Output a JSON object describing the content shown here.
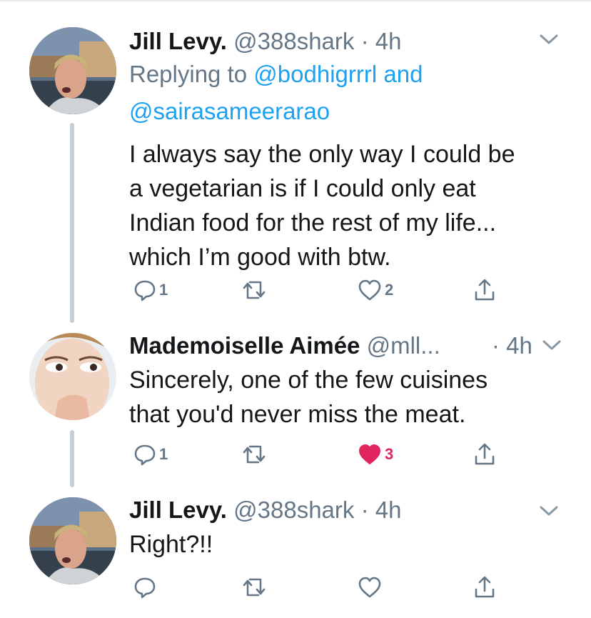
{
  "tweets": [
    {
      "name": "Jill Levy.",
      "handle": "@388shark",
      "time": "· 4h",
      "replying_prefix": "Replying to",
      "replying_mention1": "@bodhigrrrl",
      "replying_and": "and",
      "replying_mention2": "@sairasameerarao",
      "body": [
        "I always say the only way I could be",
        "a vegetarian is if I could only eat",
        "Indian food for the rest of my life...",
        "which I’m good with btw."
      ],
      "reply_count": "1",
      "retweet_count": "",
      "like_count": "2",
      "liked": false
    },
    {
      "name": "Mademoiselle Aimée",
      "handle": "@mll...",
      "time": "· 4h",
      "body": [
        "Sincerely, one of the few cuisines",
        "that you'd never miss the meat."
      ],
      "reply_count": "1",
      "retweet_count": "",
      "like_count": "3",
      "liked": true
    },
    {
      "name": "Jill Levy.",
      "handle": "@388shark",
      "time": "· 4h",
      "body": [
        "Right?!!"
      ],
      "reply_count": "",
      "retweet_count": "",
      "like_count": "",
      "liked": false
    }
  ],
  "colors": {
    "accent": "#1da1f2",
    "like": "#e0245e",
    "muted": "#657786",
    "thread": "#c4cfd6"
  },
  "icons": {
    "reply": "reply-icon",
    "retweet": "retweet-icon",
    "like": "heart-icon",
    "share": "share-icon",
    "menu": "chevron-down-icon"
  }
}
